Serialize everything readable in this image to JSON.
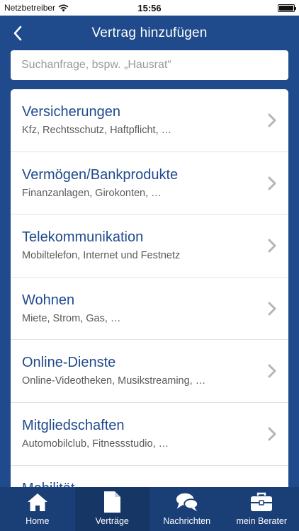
{
  "status_bar": {
    "carrier": "Netzbetreiber",
    "time": "15:56",
    "battery_level": 1.0
  },
  "header": {
    "title": "Vertrag hinzufügen",
    "back_icon": "chevron-left-icon"
  },
  "search": {
    "placeholder": "Suchanfrage, bspw. „Hausrat“",
    "value": ""
  },
  "categories": [
    {
      "title": "Versicherungen",
      "subtitle": "Kfz, Rechtsschutz, Haftpflicht, …"
    },
    {
      "title": "Vermögen/Bankprodukte",
      "subtitle": "Finanzanlagen, Girokonten, …"
    },
    {
      "title": "Telekommunikation",
      "subtitle": "Mobiltelefon, Internet und Festnetz"
    },
    {
      "title": "Wohnen",
      "subtitle": "Miete, Strom, Gas, …"
    },
    {
      "title": "Online-Dienste",
      "subtitle": "Online-Videotheken, Musikstreaming, …"
    },
    {
      "title": "Mitgliedschaften",
      "subtitle": "Automobilclub, Fitnessstudio, …"
    },
    {
      "title": "Mobilität",
      "subtitle": ""
    }
  ],
  "tab_bar": {
    "tabs": [
      {
        "label": "Home",
        "icon": "home-icon",
        "active": false
      },
      {
        "label": "Verträge",
        "icon": "document-icon",
        "active": true
      },
      {
        "label": "Nachrichten",
        "icon": "chat-bubbles-icon",
        "active": false
      },
      {
        "label": "mein Berater",
        "icon": "briefcase-icon",
        "active": false
      }
    ]
  },
  "colors": {
    "primary": "#1f4a8c",
    "tab_bar": "#1a3f77",
    "tab_active": "#163666",
    "chevron": "#b5b5b5"
  }
}
